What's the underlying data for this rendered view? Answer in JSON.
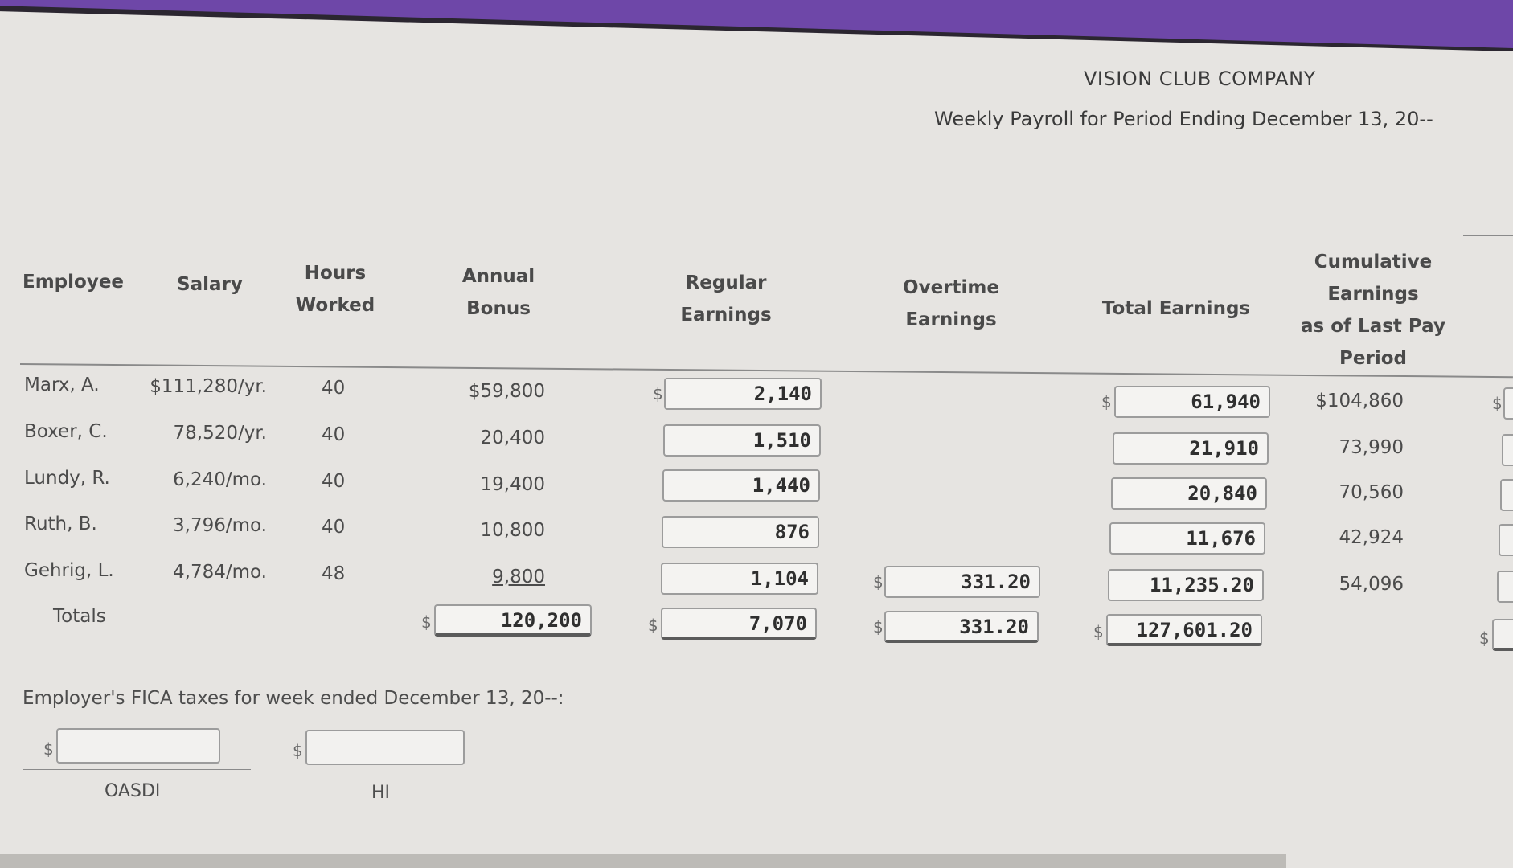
{
  "header": {
    "company": "VISION CLUB COMPANY",
    "subtitle": "Weekly Payroll for Period Ending December 13, 20--"
  },
  "columns": {
    "employee": "Employee",
    "salary": "Salary",
    "hours_1": "Hours",
    "hours_2": "Worked",
    "bonus_1": "Annual",
    "bonus_2": "Bonus",
    "regular_1": "Regular",
    "regular_2": "Earnings",
    "overtime_1": "Overtime",
    "overtime_2": "Earnings",
    "total": "Total Earnings",
    "cumulative_1": "Cumulative",
    "cumulative_2": "Earnings",
    "cumulative_3": "as of Last Pay",
    "cumulative_4": "Period"
  },
  "currency_symbol": "$",
  "rows": [
    {
      "employee": "Marx, A.",
      "salary": "$111,280/yr.",
      "hours": "40",
      "bonus": "$59,800",
      "regular": "2,140",
      "overtime": "",
      "total": "61,940",
      "cumulative": "$104,860",
      "next": ""
    },
    {
      "employee": "Boxer, C.",
      "salary": "78,520/yr.",
      "hours": "40",
      "bonus": "20,400",
      "regular": "1,510",
      "overtime": "",
      "total": "21,910",
      "cumulative": "73,990",
      "next": ""
    },
    {
      "employee": "Lundy, R.",
      "salary": "6,240/mo.",
      "hours": "40",
      "bonus": "19,400",
      "regular": "1,440",
      "overtime": "",
      "total": "20,840",
      "cumulative": "70,560",
      "next": ""
    },
    {
      "employee": "Ruth, B.",
      "salary": "3,796/mo.",
      "hours": "40",
      "bonus": "10,800",
      "regular": "876",
      "overtime": "",
      "total": "11,676",
      "cumulative": "42,924",
      "next": ""
    },
    {
      "employee": "Gehrig, L.",
      "salary": "4,784/mo.",
      "hours": "48",
      "bonus": "9,800",
      "regular": "1,104",
      "overtime": "331.20",
      "total": "11,235.20",
      "cumulative": "54,096",
      "next": ""
    }
  ],
  "totals": {
    "label": "Totals",
    "bonus": "120,200",
    "regular": "7,070",
    "overtime": "331.20",
    "total": "127,601.20",
    "next": ""
  },
  "fica": {
    "prompt": "Employer's FICA taxes for week ended December 13, 20--:",
    "oasdi_label": "OASDI",
    "oasdi_value": "",
    "hi_label": "HI",
    "hi_value": ""
  }
}
